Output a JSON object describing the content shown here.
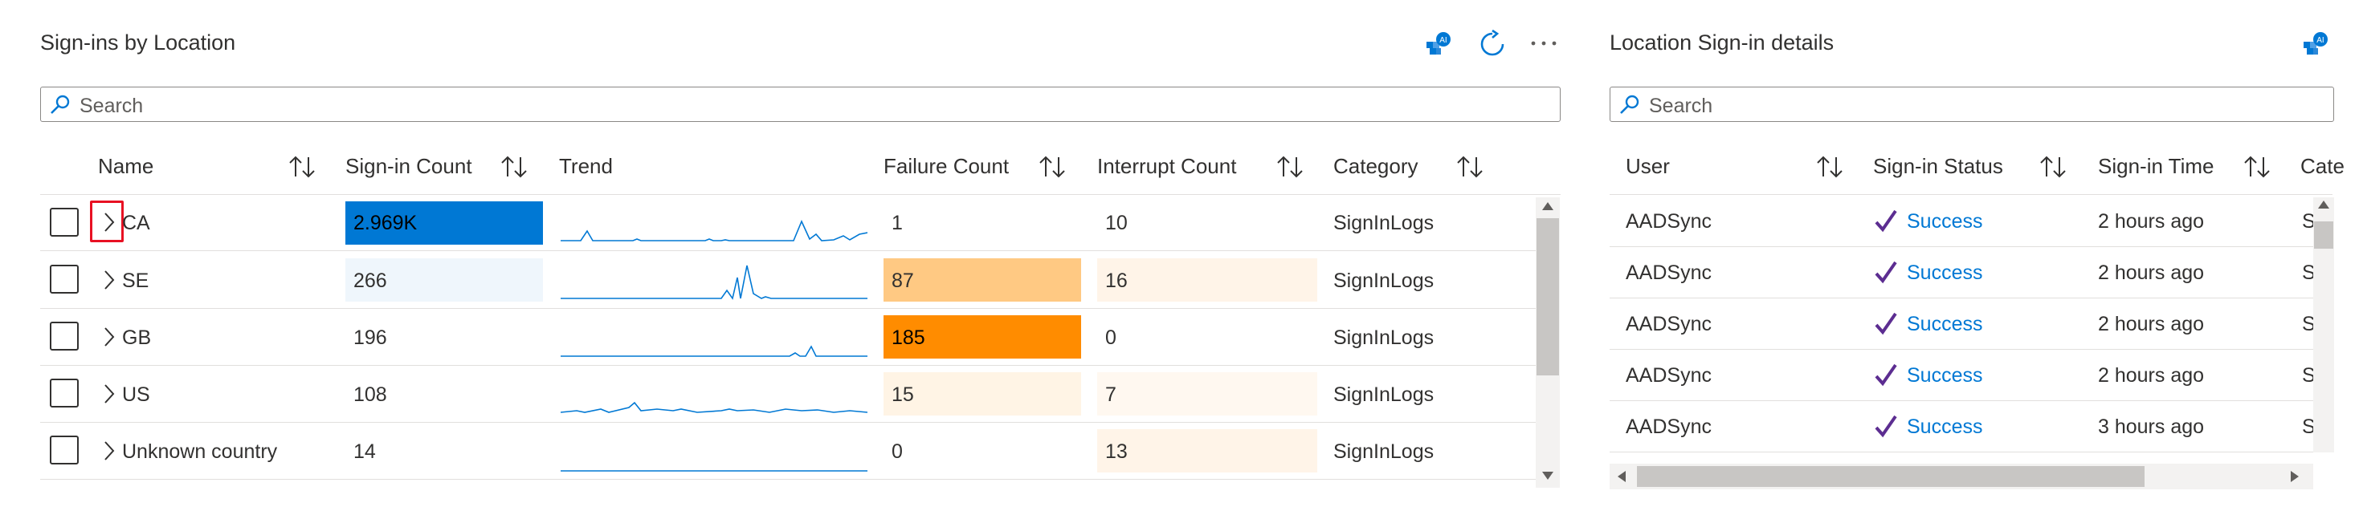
{
  "left_panel": {
    "title": "Sign-ins by Location",
    "search_placeholder": "Search",
    "columns": {
      "name": "Name",
      "signin_count": "Sign-in Count",
      "trend": "Trend",
      "failure_count": "Failure Count",
      "interrupt_count": "Interrupt Count",
      "category": "Category"
    },
    "rows": [
      {
        "name": "CA",
        "signin_count": "2.969K",
        "signin_fill": 1.0,
        "failure_count": "1",
        "failure_fill": 0.0,
        "interrupt_count": "10",
        "interrupt_fill": 0.0,
        "category": "SignInLogs"
      },
      {
        "name": "SE",
        "signin_count": "266",
        "signin_fill": 0.09,
        "failure_count": "87",
        "failure_fill": 0.47,
        "interrupt_count": "16",
        "interrupt_fill": 1.0,
        "category": "SignInLogs"
      },
      {
        "name": "GB",
        "signin_count": "196",
        "signin_fill": 0.07,
        "failure_count": "185",
        "failure_fill": 1.0,
        "interrupt_count": "0",
        "interrupt_fill": 0.0,
        "category": "SignInLogs"
      },
      {
        "name": "US",
        "signin_count": "108",
        "signin_fill": 0.04,
        "failure_count": "15",
        "failure_fill": 0.08,
        "interrupt_count": "7",
        "interrupt_fill": 0.44,
        "category": "SignInLogs"
      },
      {
        "name": "Unknown country",
        "signin_count": "14",
        "signin_fill": 0.0,
        "failure_count": "0",
        "failure_fill": 0.0,
        "interrupt_count": "13",
        "interrupt_fill": 0.81,
        "category": "SignInLogs"
      }
    ]
  },
  "right_panel": {
    "title": "Location Sign-in details",
    "search_placeholder": "Search",
    "columns": {
      "user": "User",
      "signin_status": "Sign-in Status",
      "signin_time": "Sign-in Time",
      "category_partial": "Cate"
    },
    "rows": [
      {
        "user": "AADSync",
        "status": "Success",
        "time": "2 hours ago",
        "cat": "S"
      },
      {
        "user": "AADSync",
        "status": "Success",
        "time": "2 hours ago",
        "cat": "S"
      },
      {
        "user": "AADSync",
        "status": "Success",
        "time": "2 hours ago",
        "cat": "S"
      },
      {
        "user": "AADSync",
        "status": "Success",
        "time": "2 hours ago",
        "cat": "S"
      },
      {
        "user": "AADSync",
        "status": "Success",
        "time": "3 hours ago",
        "cat": "S"
      }
    ]
  },
  "icons": {
    "insights": "insights-icon",
    "refresh": "refresh-icon",
    "more": "more-icon",
    "search": "search-icon",
    "sort": "sort-icon",
    "chevron": "chevron-right-icon",
    "check": "checkmark-icon"
  },
  "colors": {
    "signin_bar_strong": "#0078d4",
    "signin_bar_light": "#eff6fc",
    "failure_bar_strong": "#ff8c00",
    "failure_bar_mid": "#ffc983",
    "failure_bar_light": "#fff4e5",
    "interrupt_bar_light": "#fff4e8",
    "success_text": "#0078d4",
    "check_color": "#5c2d91",
    "highlight_box": "#e81123"
  }
}
